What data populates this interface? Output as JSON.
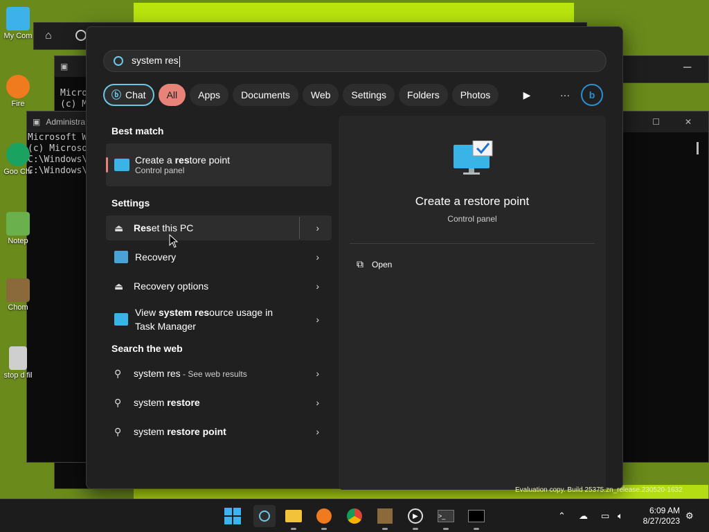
{
  "desktop": {
    "icons": [
      {
        "label": "My Com",
        "color": "#3db2ea"
      },
      {
        "label": "Fire",
        "color": "#f07a1e"
      },
      {
        "label": "Goo Chr",
        "color": "#1aa260"
      },
      {
        "label": "Notep",
        "color": "#6ab04c"
      },
      {
        "label": "Chom",
        "color": "#8a6a3b"
      },
      {
        "label": "stop d fil",
        "color": "#cfcfcf"
      }
    ],
    "console_back": {
      "title": "Administra",
      "lines": [
        "Microsoft W",
        "(c) Microso",
        "",
        "C:\\Windows\\",
        "",
        "C:\\Windows\\"
      ]
    },
    "console_back2_lines": [
      "Micro",
      "(c) M"
    ],
    "watermark": "Evaluation copy. Build 25375.zn_release.230520-1632"
  },
  "search": {
    "query": "system res",
    "filters": [
      {
        "label": "Chat",
        "state": "chat"
      },
      {
        "label": "All",
        "state": "active"
      },
      {
        "label": "Apps",
        "state": ""
      },
      {
        "label": "Documents",
        "state": ""
      },
      {
        "label": "Web",
        "state": ""
      },
      {
        "label": "Settings",
        "state": ""
      },
      {
        "label": "Folders",
        "state": ""
      },
      {
        "label": "Photos",
        "state": ""
      }
    ],
    "more_label": "···",
    "best_match": {
      "heading": "Best match",
      "title_pre": "Create a ",
      "title_bold": "res",
      "title_post": "tore point",
      "subtitle": "Control panel"
    },
    "settings": {
      "heading": "Settings",
      "items": [
        {
          "pre": "",
          "bold": "Res",
          "post": "et this PC"
        },
        {
          "pre": "Recovery",
          "bold": "",
          "post": ""
        },
        {
          "pre": "Recovery options",
          "bold": "",
          "post": ""
        },
        {
          "pre": "View ",
          "bold": "system res",
          "post": "ource usage in",
          "line2": "Task Manager"
        }
      ]
    },
    "web": {
      "heading": "Search the web",
      "items": [
        {
          "text": "system res",
          "extra": " - See web results"
        },
        {
          "text": "system ",
          "bold": "restore"
        },
        {
          "text": "system ",
          "bold": "restore point"
        }
      ]
    },
    "preview": {
      "title": "Create a restore point",
      "kind": "Control panel",
      "action": "Open"
    }
  },
  "taskbar": {
    "time": "6:09 AM",
    "date": "8/27/2023"
  },
  "colors": {
    "accent": "#e8837a",
    "chat_border": "#6bc9e8",
    "desktop": "#6a8a1c"
  }
}
